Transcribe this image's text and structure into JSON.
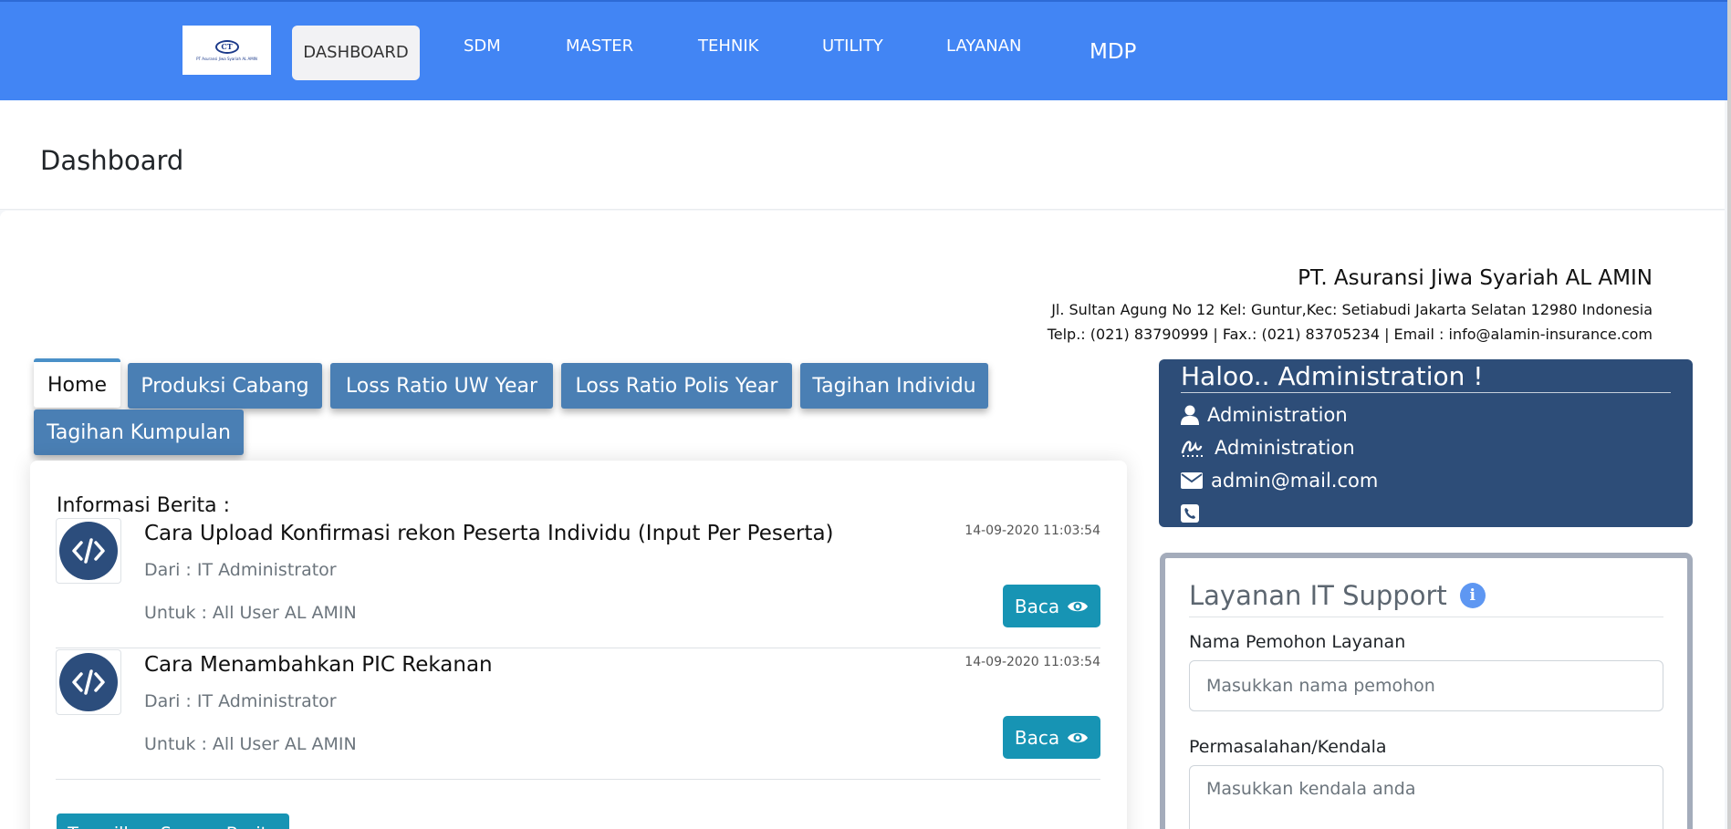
{
  "nav": {
    "logo_mark": "CT",
    "logo_text": "PT Asuransi Jiwa Syariah AL AMIN",
    "items": [
      "DASHBOARD",
      "SDM",
      "MASTER",
      "TEHNIK",
      "UTILITY",
      "LAYANAN",
      "MDP"
    ],
    "active": "DASHBOARD"
  },
  "page": {
    "title": "Dashboard"
  },
  "company": {
    "name": "PT. Asuransi Jiwa Syariah AL AMIN",
    "address": "Jl. Sultan Agung No 12 Kel: Guntur,Kec: Setiabudi Jakarta Selatan 12980 Indonesia",
    "contact": "Telp.: (021) 83790999 | Fax.: (021) 83705234 | Email : info@alamin-insurance.com"
  },
  "tabs": [
    "Home",
    "Produksi Cabang",
    "Loss Ratio UW Year",
    "Loss Ratio Polis Year",
    "Tagihan Individu",
    "Tagihan Kumpulan"
  ],
  "news": {
    "heading": "Informasi Berita :",
    "items": [
      {
        "title": "Cara Upload Konfirmasi rekon Peserta Individu (Input Per Peserta)",
        "date": "14-09-2020 11:03:54",
        "from": "Dari : IT Administrator",
        "to": "Untuk : All User AL AMIN",
        "button": "Baca",
        "icon": "code-icon"
      },
      {
        "title": "Cara Menambahkan PIC Rekanan",
        "date": "14-09-2020 11:03:54",
        "from": "Dari : IT Administrator",
        "to": "Untuk : All User AL AMIN",
        "button": "Baca",
        "icon": "code-icon"
      }
    ],
    "show_all": "Tampilkan Semua Berita"
  },
  "profile": {
    "greeting": "Haloo.. Administration !",
    "name": "Administration",
    "signature": "Administration",
    "email": "admin@mail.com",
    "phone": ""
  },
  "support": {
    "title": "Layanan IT Support",
    "name_label": "Nama Pemohon Layanan",
    "name_placeholder": "Masukkan nama pemohon",
    "issue_label": "Permasalahan/Kendala",
    "issue_placeholder": "Masukkan kendala anda"
  },
  "colors": {
    "navbar": "#4285f4",
    "tab": "#4a7fb4",
    "button": "#1794b4",
    "profile_card": "#2d4d78"
  }
}
